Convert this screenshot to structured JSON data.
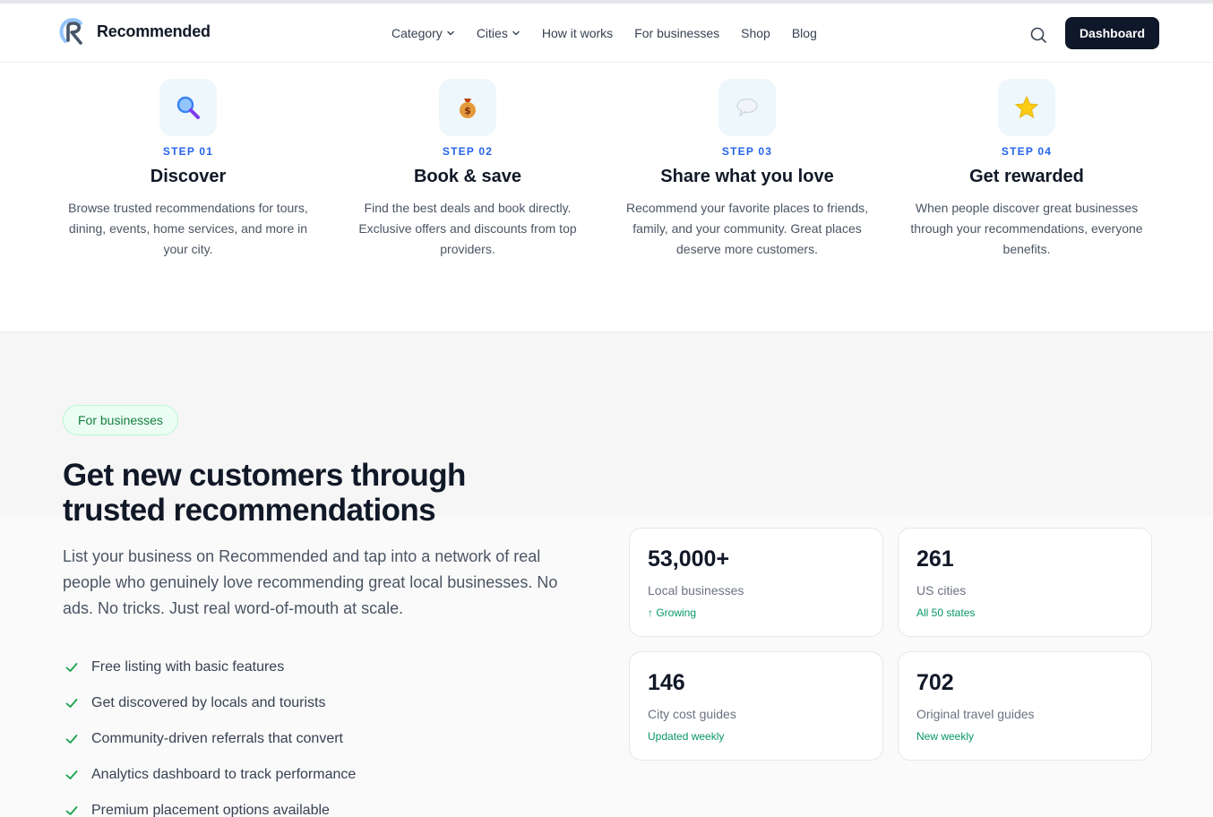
{
  "header": {
    "brand": "Recommended",
    "nav": [
      {
        "label": "Category",
        "dropdown": true
      },
      {
        "label": "Cities",
        "dropdown": true
      },
      {
        "label": "How it works",
        "dropdown": false
      },
      {
        "label": "For businesses",
        "dropdown": false
      },
      {
        "label": "Shop",
        "dropdown": false
      },
      {
        "label": "Blog",
        "dropdown": false
      }
    ],
    "search_icon": "search-icon",
    "dashboard_label": "Dashboard"
  },
  "steps": [
    {
      "icon": "magnifier-icon",
      "num": "STEP 01",
      "title": "Discover",
      "desc": "Browse trusted recommendations for tours, dining, events, home services, and more in your city."
    },
    {
      "icon": "money-bag-icon",
      "num": "STEP 02",
      "title": "Book & save",
      "desc": "Find the best deals and book directly. Exclusive offers and discounts from top providers."
    },
    {
      "icon": "speech-bubble-icon",
      "num": "STEP 03",
      "title": "Share what you love",
      "desc": "Recommend your favorite places to friends, family, and your community. Great places deserve more customers."
    },
    {
      "icon": "star-icon",
      "num": "STEP 04",
      "title": "Get rewarded",
      "desc": "When people discover great businesses through your recommendations, everyone benefits."
    }
  ],
  "business": {
    "pill": "For businesses",
    "title": "Get new customers through trusted recommendations",
    "desc": "List your business on Recommended and tap into a network of real people who genuinely love recommending great local businesses. No ads. No tricks. Just real word-of-mouth at scale.",
    "features": [
      "Free listing with basic features",
      "Get discovered by locals and tourists",
      "Community-driven referrals that convert",
      "Analytics dashboard to track performance",
      "Premium placement options available"
    ],
    "stats": [
      {
        "value": "53,000+",
        "label": "Local businesses",
        "sub": "↑ Growing"
      },
      {
        "value": "261",
        "label": "US cities",
        "sub": "All 50 states"
      },
      {
        "value": "146",
        "label": "City cost guides",
        "sub": "Updated weekly"
      },
      {
        "value": "702",
        "label": "Original travel guides",
        "sub": "New weekly"
      }
    ]
  },
  "colors": {
    "accent_blue": "#2563eb",
    "accent_green": "#059669",
    "dark_button": "#0f172a"
  }
}
